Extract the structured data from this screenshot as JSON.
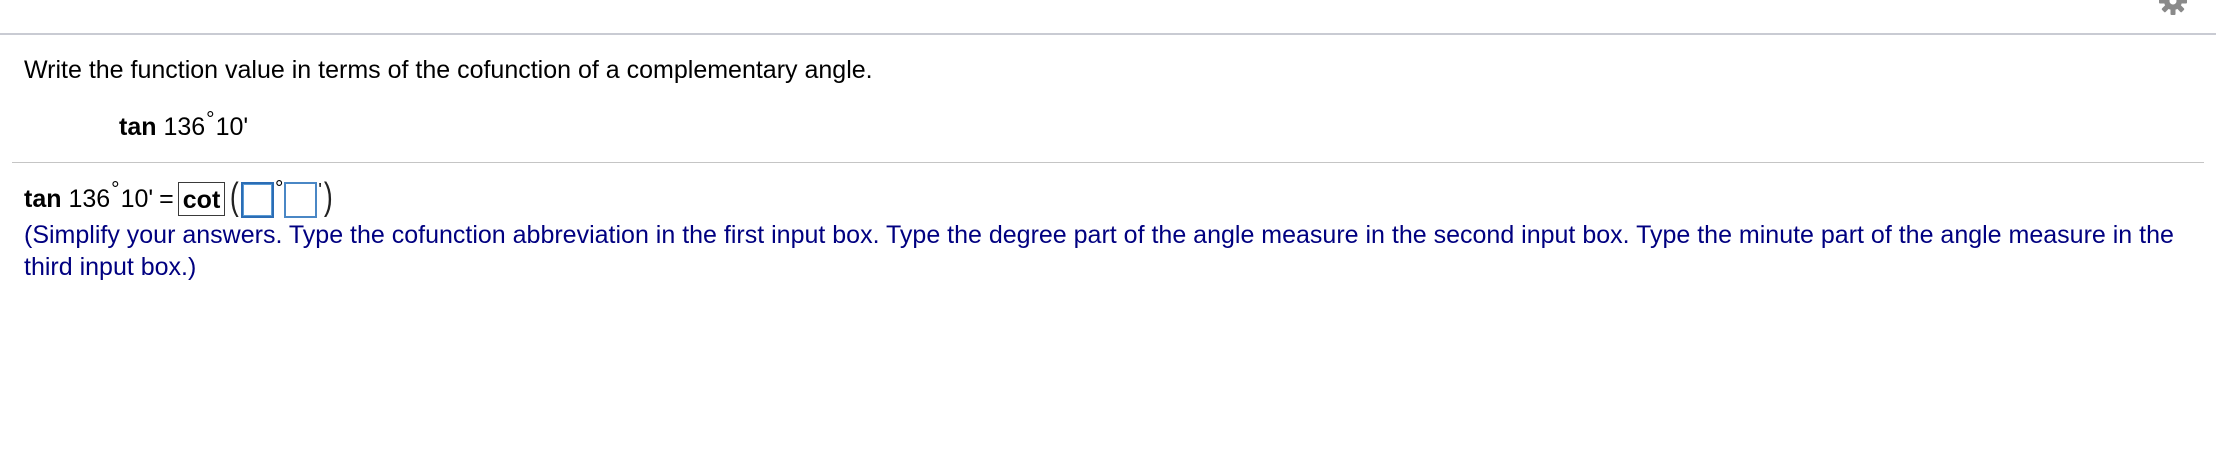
{
  "question": {
    "instruction": "Write the function value in terms of the cofunction of a complementary angle.",
    "expression": {
      "function": "tan",
      "angle_degrees": "136",
      "degree_symbol": "°",
      "angle_minutes": "10'"
    }
  },
  "answer": {
    "function": "tan",
    "angle_degrees": "136",
    "degree_symbol": "°",
    "angle_minutes": "10'",
    "equals": "=",
    "cofunction_value": "cot",
    "open_paren": "(",
    "degree_input_value": "",
    "degree_sep": "°",
    "minute_input_value": "",
    "minute_sep": "'",
    "close_paren": ")"
  },
  "hint": "(Simplify your answers. Type the cofunction abbreviation in the first input box. Type the degree part of the angle measure in the second input box. Type the minute part of the angle measure in the third input box.)",
  "icons": {
    "settings": "gear-icon"
  },
  "colors": {
    "hint_text": "#000080",
    "input_border": "#4a87c5",
    "divider": "#c9cbd3"
  }
}
